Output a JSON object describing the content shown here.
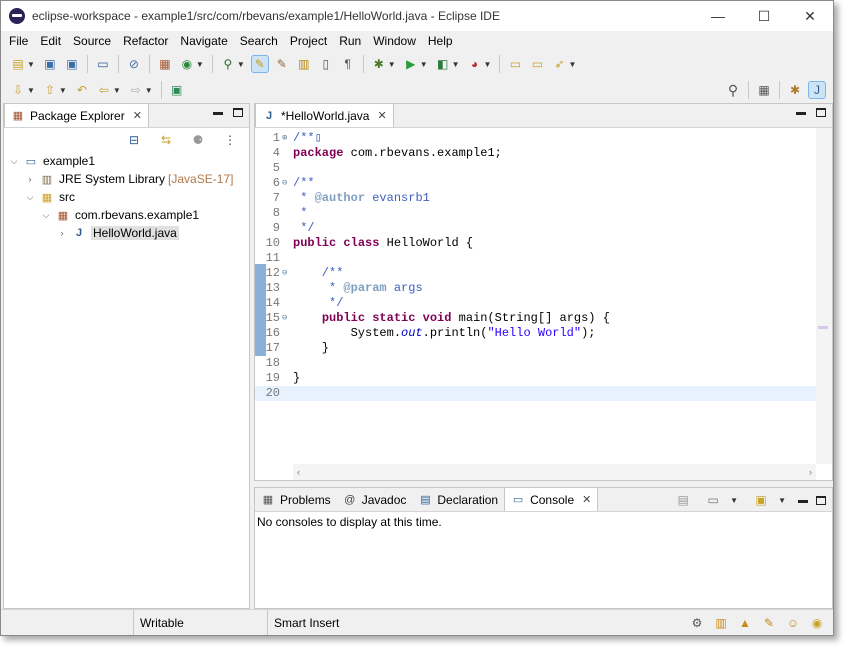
{
  "window": {
    "title": "eclipse-workspace - example1/src/com/rbevans/example1/HelloWorld.java - Eclipse IDE",
    "minimize": "—",
    "maximize": "☐",
    "close": "✕"
  },
  "menu": [
    "File",
    "Edit",
    "Source",
    "Refactor",
    "Navigate",
    "Search",
    "Project",
    "Run",
    "Window",
    "Help"
  ],
  "package_explorer": {
    "tab_label": "Package Explorer",
    "tree": {
      "project": "example1",
      "jre": "JRE System Library",
      "jre_decoration": "[JavaSE-17]",
      "src": "src",
      "package": "com.rbevans.example1",
      "file": "HelloWorld.java"
    }
  },
  "editor": {
    "tab_label": "*HelloWorld.java",
    "lines": [
      {
        "n": "1",
        "fold": "⊕",
        "segments": [
          {
            "t": "/**",
            "c": "cm"
          },
          {
            "t": "▯",
            "c": "cm"
          }
        ]
      },
      {
        "n": "4",
        "fold": "",
        "segments": [
          {
            "t": "package",
            "c": "kw"
          },
          {
            "t": " com.rbevans.example1;",
            "c": ""
          }
        ]
      },
      {
        "n": "5",
        "fold": "",
        "segments": []
      },
      {
        "n": "6",
        "fold": "⊖",
        "segments": [
          {
            "t": "/**",
            "c": "cm"
          }
        ]
      },
      {
        "n": "7",
        "fold": "",
        "segments": [
          {
            "t": " * ",
            "c": "cm"
          },
          {
            "t": "@author",
            "c": "tag"
          },
          {
            "t": " evansrb1",
            "c": "cm"
          }
        ]
      },
      {
        "n": "8",
        "fold": "",
        "segments": [
          {
            "t": " *",
            "c": "cm"
          }
        ]
      },
      {
        "n": "9",
        "fold": "",
        "segments": [
          {
            "t": " */",
            "c": "cm"
          }
        ]
      },
      {
        "n": "10",
        "fold": "",
        "segments": [
          {
            "t": "public",
            "c": "kw"
          },
          {
            "t": " ",
            "c": ""
          },
          {
            "t": "class",
            "c": "kw"
          },
          {
            "t": " HelloWorld {",
            "c": ""
          }
        ]
      },
      {
        "n": "11",
        "fold": "",
        "segments": []
      },
      {
        "n": "12",
        "fold": "⊖",
        "segments": [
          {
            "t": "    /**",
            "c": "cm"
          }
        ]
      },
      {
        "n": "13",
        "fold": "",
        "segments": [
          {
            "t": "     * ",
            "c": "cm"
          },
          {
            "t": "@param",
            "c": "tag"
          },
          {
            "t": " args",
            "c": "cm"
          }
        ]
      },
      {
        "n": "14",
        "fold": "",
        "segments": [
          {
            "t": "     */",
            "c": "cm"
          }
        ]
      },
      {
        "n": "15",
        "fold": "⊖",
        "segments": [
          {
            "t": "    ",
            "c": ""
          },
          {
            "t": "public",
            "c": "kw"
          },
          {
            "t": " ",
            "c": ""
          },
          {
            "t": "static",
            "c": "kw"
          },
          {
            "t": " ",
            "c": ""
          },
          {
            "t": "void",
            "c": "kw"
          },
          {
            "t": " main(String[] args) {",
            "c": ""
          }
        ]
      },
      {
        "n": "16",
        "fold": "",
        "segments": [
          {
            "t": "        System.",
            "c": ""
          },
          {
            "t": "out",
            "c": "fld"
          },
          {
            "t": ".println(",
            "c": ""
          },
          {
            "t": "\"Hello World\"",
            "c": "str"
          },
          {
            "t": ");",
            "c": ""
          }
        ]
      },
      {
        "n": "17",
        "fold": "",
        "segments": [
          {
            "t": "    }",
            "c": ""
          }
        ]
      },
      {
        "n": "18",
        "fold": "",
        "segments": []
      },
      {
        "n": "19",
        "fold": "",
        "segments": [
          {
            "t": "}",
            "c": ""
          }
        ]
      },
      {
        "n": "20",
        "fold": "",
        "segments": []
      }
    ]
  },
  "bottom_panel": {
    "tabs": [
      {
        "label": "Problems",
        "icon": "problems-icon",
        "glyph": "▦"
      },
      {
        "label": "Javadoc",
        "icon": "javadoc-icon",
        "glyph": "@"
      },
      {
        "label": "Declaration",
        "icon": "declaration-icon",
        "glyph": "▤"
      },
      {
        "label": "Console",
        "icon": "console-icon",
        "glyph": "▭"
      }
    ],
    "active_tab": "Console",
    "message": "No consoles to display at this time."
  },
  "statusbar": {
    "writable": "Writable",
    "insert_mode": "Smart Insert"
  },
  "colors": {
    "keyword": "#7f0055",
    "comment": "#3f5fbf",
    "javadoc_tag": "#7f9fbf",
    "string": "#2a00ff",
    "current_line": "#e8f2fe"
  }
}
